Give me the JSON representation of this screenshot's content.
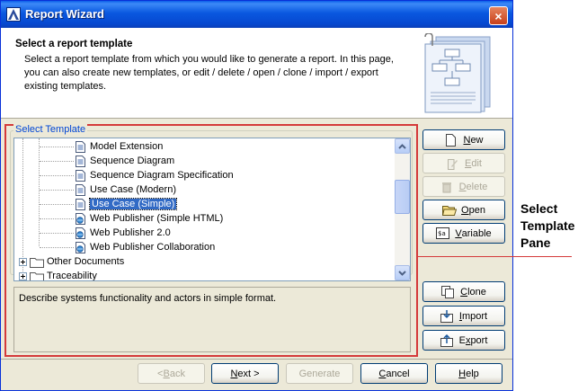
{
  "window": {
    "title": "Report Wizard",
    "close_label": "×"
  },
  "header": {
    "title": "Select a report template",
    "description": "Select a report template from which you would like to generate a report. In this page, you can also create new templates, or edit / delete / open / clone / import / export existing templates."
  },
  "template_pane": {
    "group_label": "Select Template",
    "tree_items": [
      {
        "label": "Model Extension",
        "type": "document"
      },
      {
        "label": "Sequence Diagram",
        "type": "document"
      },
      {
        "label": "Sequence Diagram Specification",
        "type": "document"
      },
      {
        "label": "Use Case (Modern)",
        "type": "document"
      },
      {
        "label": "Use Case (Simple)",
        "type": "document",
        "selected": true
      },
      {
        "label": "Web Publisher (Simple HTML)",
        "type": "web-document"
      },
      {
        "label": "Web Publisher 2.0",
        "type": "web-document"
      },
      {
        "label": "Web Publisher Collaboration",
        "type": "web-document"
      },
      {
        "label": "Other Documents",
        "type": "folder"
      },
      {
        "label": "Traceability",
        "type": "folder"
      }
    ],
    "description": "Describe systems functionality and actors in simple format."
  },
  "side_buttons": {
    "new": {
      "mnemonic": "N",
      "rest": "ew"
    },
    "edit": {
      "mnemonic": "E",
      "rest": "dit"
    },
    "delete": {
      "mnemonic": "D",
      "rest": "elete"
    },
    "open": {
      "mnemonic": "O",
      "rest": "pen"
    },
    "variable": {
      "mnemonic": "V",
      "rest": "ariable"
    },
    "clone": {
      "mnemonic": "C",
      "rest": "lone"
    },
    "import": {
      "mnemonic": "I",
      "rest": "mport"
    },
    "export": {
      "mnemonic": "x",
      "pre": "E",
      "rest": "port"
    }
  },
  "footer": {
    "back": {
      "pre": "< ",
      "mnemonic": "B",
      "rest": "ack"
    },
    "next": {
      "pre": "",
      "mnemonic": "N",
      "rest": "ext >"
    },
    "generate": "Generate",
    "cancel": {
      "pre": "",
      "mnemonic": "C",
      "rest": "ancel"
    },
    "help": {
      "pre": "",
      "mnemonic": "H",
      "rest": "elp"
    }
  },
  "callout": {
    "line1": "Select",
    "line2": "Template",
    "line3": "Pane"
  },
  "colors": {
    "highlight_frame": "#d43a3a",
    "selection": "#316ac5",
    "titlebar": "#0a58e0"
  }
}
